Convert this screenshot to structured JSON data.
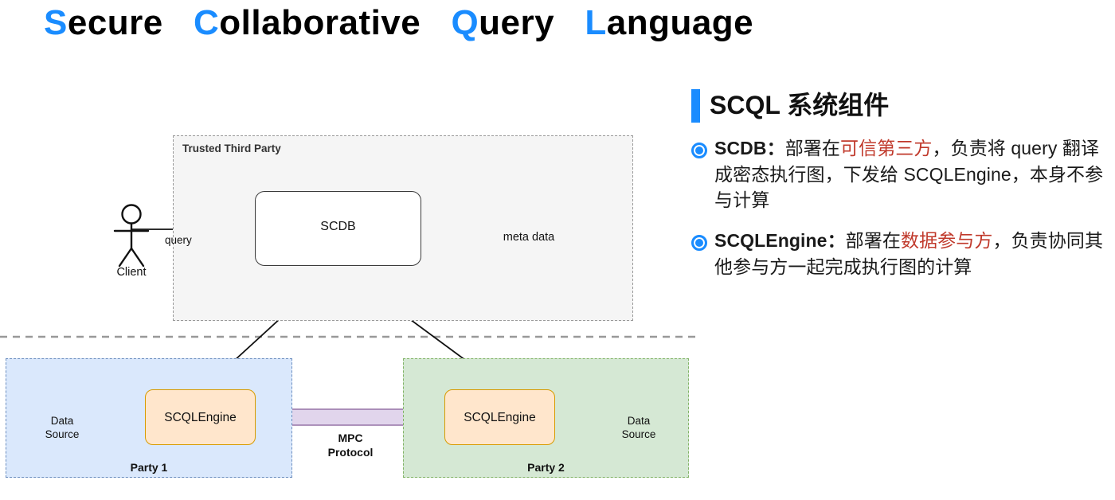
{
  "title": {
    "parts": [
      {
        "cap": "S",
        "rest": "ecure"
      },
      {
        "cap": "C",
        "rest": "ollaborative"
      },
      {
        "cap": "Q",
        "rest": "uery"
      },
      {
        "cap": "L",
        "rest": "anguage"
      }
    ],
    "full_text": "Secure Collaborative Query Language",
    "accent_color": "#1a8cff",
    "text_color": "#000000"
  },
  "panel": {
    "heading": "SCQL 系统组件",
    "accent_color": "#1a8cff",
    "highlight_color": "#c0392b",
    "bullets": [
      {
        "term": "SCDB",
        "separator": "：",
        "before": "部署在",
        "highlight": "可信第三方",
        "after": "，负责将 query 翻译成密态执行图，下发给 SCQLEngine，本身不参与计算",
        "full_text": "SCDB：部署在可信第三方，负责将 query 翻译成密态执行图，下发给 SCQLEngine，本身不参与计算"
      },
      {
        "term": "SCQLEngine",
        "separator": "：",
        "before": "部署在",
        "highlight": "数据参与方",
        "after": "，负责协同其他参与方一起完成执行图的计算",
        "full_text": "SCQLEngine：部署在数据参与方，负责协同其他参与方一起完成执行图的计算"
      }
    ]
  },
  "diagram": {
    "trusted_third_party": {
      "title": "Trusted Third Party",
      "fill": "#f5f5f5",
      "border": "#999999"
    },
    "client": {
      "label": "Client"
    },
    "query": {
      "label": "query",
      "icon": "json-document-icon",
      "icon_glyph": "{}"
    },
    "scdb": {
      "label": "SCDB",
      "fill": "#ffffff",
      "border": "#3b3b3b"
    },
    "metadata": {
      "label": "meta data"
    },
    "party1": {
      "label": "Party 1",
      "fill": "#dae8fc",
      "border": "#6c8ebf",
      "datasource_label": "Data\nSource",
      "datasource_line1": "Data",
      "datasource_line2": "Source",
      "engine_label": "SCQLEngine",
      "engine_fill": "#ffe6cc",
      "engine_border": "#d79b00"
    },
    "party2": {
      "label": "Party 2",
      "fill": "#d5e8d4",
      "border": "#82b366",
      "datasource_label": "Data\nSource",
      "datasource_line1": "Data",
      "datasource_line2": "Source",
      "engine_label": "SCQLEngine",
      "engine_fill": "#ffe6cc",
      "engine_border": "#d79b00"
    },
    "mpc": {
      "label_line1": "MPC",
      "label_line2": "Protocol",
      "arrow_fill": "#e1d5ec",
      "arrow_border": "#9673a6"
    },
    "divider": {
      "color": "#999999",
      "style": "dashed"
    }
  }
}
